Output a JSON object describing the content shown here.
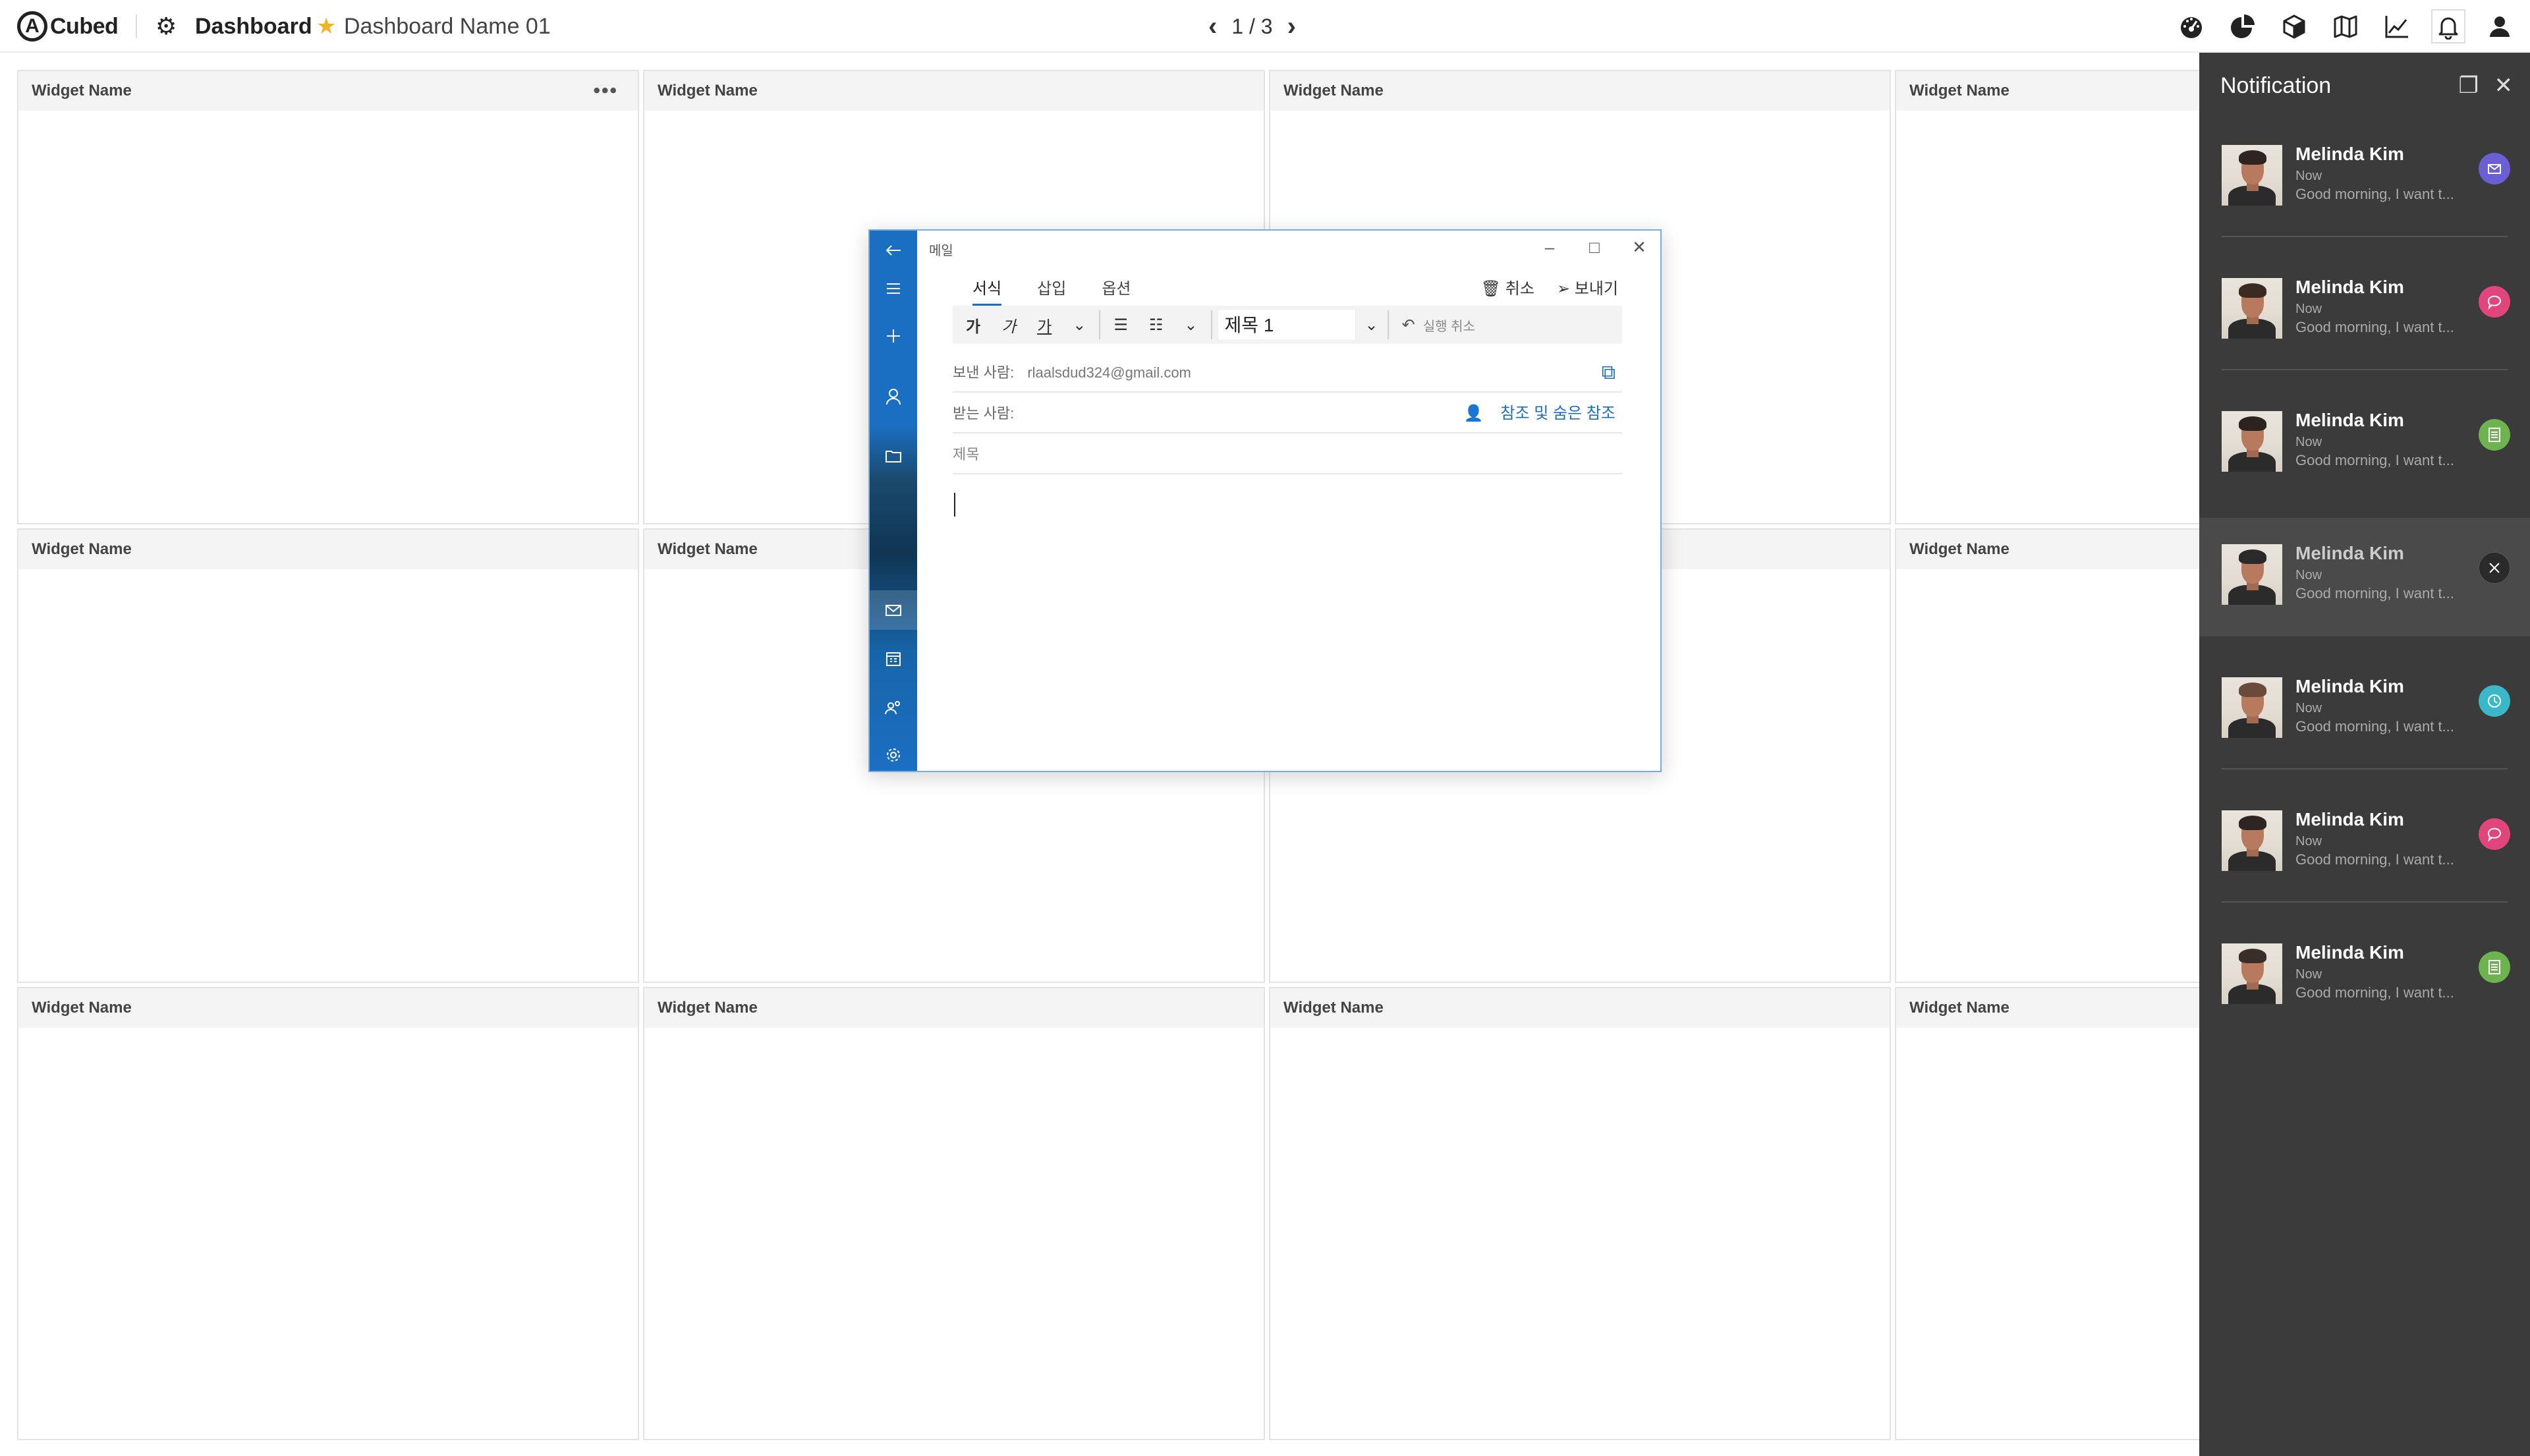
{
  "app": {
    "logo_letter": "A",
    "logo_text": "Cubed",
    "section": "Dashboard",
    "dashboard_name": "Dashboard Name 01",
    "page": "1 / 3"
  },
  "toolbar_icons": [
    "dashboard-gauge-icon",
    "pie-chart-icon",
    "cube-icon",
    "map-icon",
    "line-chart-icon",
    "bell-icon",
    "user-icon"
  ],
  "widgets": {
    "title": "Widget Name",
    "menu": "•••"
  },
  "mail": {
    "title": "메일",
    "tabs": [
      "서식",
      "삽입",
      "옵션"
    ],
    "discard": "취소",
    "send": "보내기",
    "format": {
      "bold": "가",
      "italic": "가",
      "underline": "가",
      "style": "제목 1",
      "undo": "실행 취소"
    },
    "from_label": "보낸 사람:",
    "from_value": "rlaalsdud324@gmail.com",
    "to_label": "받는 사람:",
    "cc_label": "참조 및 숨은 참조",
    "subject_placeholder": "제목"
  },
  "notification": {
    "title": "Notification",
    "items": [
      {
        "name": "Melinda Kim",
        "time": "Now",
        "message": "Good morning, I want t...",
        "badge": "mail-icon",
        "badge_color": "#6b5fd6"
      },
      {
        "name": "Melinda Kim",
        "time": "Now",
        "message": "Good morning, I want t...",
        "badge": "chat-icon",
        "badge_color": "#e0457b"
      },
      {
        "name": "Melinda Kim",
        "time": "Now",
        "message": "Good morning, I want t...",
        "badge": "list-icon",
        "badge_color": "#6db34f"
      },
      {
        "name": "Melinda Kim",
        "time": "Now",
        "message": "Good morning, I want t...",
        "badge": "close-icon",
        "badge_color": "#2a2a2a"
      },
      {
        "name": "Melinda Kim",
        "time": "Now",
        "message": "Good morning, I want t...",
        "badge": "clock-icon",
        "badge_color": "#3ab7c9"
      },
      {
        "name": "Melinda Kim",
        "time": "Now",
        "message": "Good morning, I want t...",
        "badge": "chat-icon",
        "badge_color": "#e0457b"
      },
      {
        "name": "Melinda Kim",
        "time": "Now",
        "message": "Good morning, I want t...",
        "badge": "list-icon",
        "badge_color": "#6db34f"
      }
    ]
  }
}
